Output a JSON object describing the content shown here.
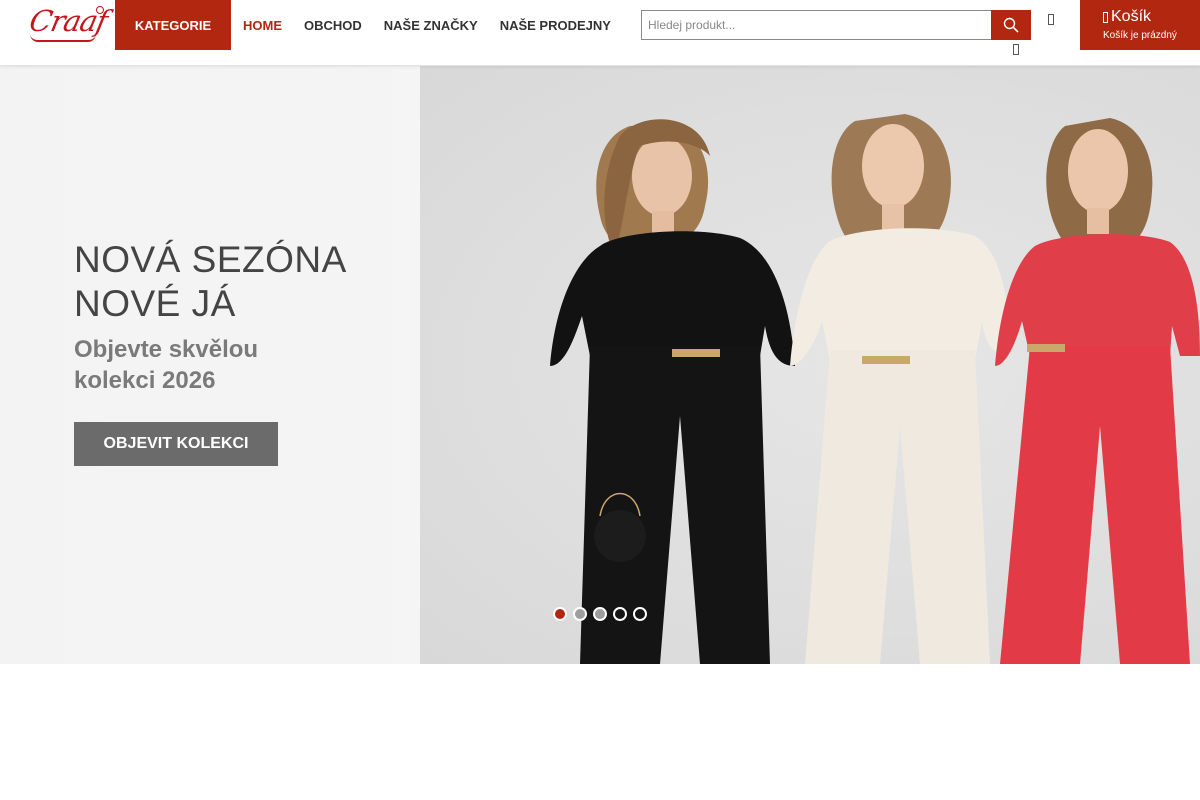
{
  "brand": {
    "name": "Craaf"
  },
  "header": {
    "kategorie_label": "KATEGORIE",
    "nav": [
      {
        "label": "HOME",
        "active": true
      },
      {
        "label": "OBCHOD",
        "active": false
      },
      {
        "label": "NAŠE ZNAČKY",
        "active": false
      },
      {
        "label": "NAŠE PRODEJNY",
        "active": false
      }
    ],
    "search": {
      "placeholder": "Hledej produkt...",
      "button_icon": "search-icon"
    },
    "account_icon": "user-icon",
    "wishlist_icon": "heart-icon",
    "cart": {
      "title": "Košík",
      "subtitle": "Košík je prázdný",
      "icon": "cart-icon"
    }
  },
  "hero": {
    "title_line1": "NOVÁ SEZÓNA",
    "title_line2": "NOVÉ JÁ",
    "subtitle_line1": "Objevte skvělou",
    "subtitle_line2": "kolekci 2026",
    "cta_label": "OBJEVIT KOLEKCI",
    "slides_total": 5,
    "active_slide": 1
  },
  "colors": {
    "accent": "#b22710",
    "button_gray": "#6b6b6b"
  }
}
